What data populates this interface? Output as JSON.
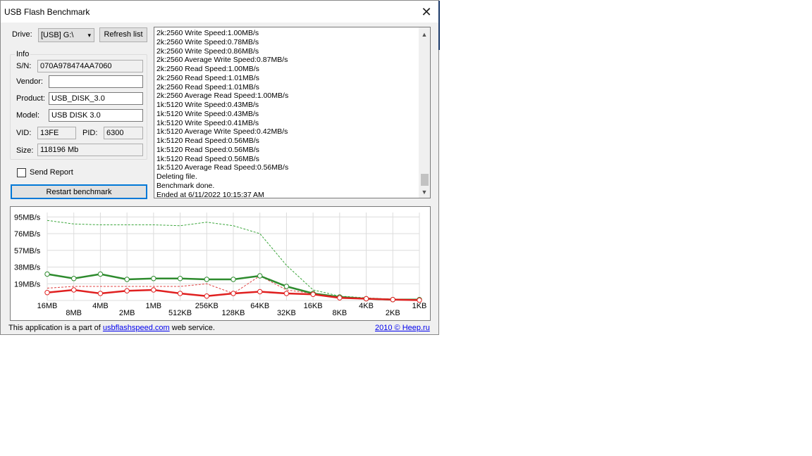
{
  "window": {
    "title": "USB Flash Benchmark",
    "close_glyph": "✕"
  },
  "drive": {
    "label": "Drive:",
    "selected": "[USB] G:\\",
    "refresh_label": "Refresh list"
  },
  "info": {
    "group_label": "Info",
    "sn_label": "S/N:",
    "sn_value": "070A978474AA7060",
    "vendor_label": "Vendor:",
    "vendor_value": "",
    "product_label": "Product:",
    "product_value": "USB_DISK_3.0",
    "model_label": "Model:",
    "model_value": "USB DISK 3.0",
    "vid_label": "VID:",
    "vid_value": "13FE",
    "pid_label": "PID:",
    "pid_value": "6300",
    "size_label": "Size:",
    "size_value": "118196 Mb"
  },
  "send_report": {
    "label": "Send Report",
    "checked": false
  },
  "restart_label": "Restart benchmark",
  "log": {
    "lines": [
      "2k:2560 Write Speed:1.00MB/s",
      "2k:2560 Write Speed:0.78MB/s",
      "2k:2560 Write Speed:0.86MB/s",
      "2k:2560 Average Write Speed:0.87MB/s",
      "2k:2560 Read Speed:1.00MB/s",
      "2k:2560 Read Speed:1.01MB/s",
      "2k:2560 Read Speed:1.01MB/s",
      "2k:2560 Average Read Speed:1.00MB/s",
      "1k:5120 Write Speed:0.43MB/s",
      "1k:5120 Write Speed:0.43MB/s",
      "1k:5120 Write Speed:0.41MB/s",
      "1k:5120 Average Write Speed:0.42MB/s",
      "1k:5120 Read Speed:0.56MB/s",
      "1k:5120 Read Speed:0.56MB/s",
      "1k:5120 Read Speed:0.56MB/s",
      "1k:5120 Average Read Speed:0.56MB/s",
      "Deleting file.",
      "Benchmark done.",
      "Ended at 6/11/2022 10:15:37 AM"
    ],
    "scroll_up": "▲",
    "scroll_down": "▼"
  },
  "footer": {
    "prefix": "This application is a part of ",
    "link": "usbflashspeed.com",
    "suffix": " web service.",
    "credit": "2010 © Heep.ru"
  },
  "colors": {
    "read": "#2e8b2e",
    "write": "#e02020",
    "read_max": "#3aa53a",
    "write_max": "#e04040",
    "grid": "#dcdcdc"
  },
  "chart_data": {
    "type": "line",
    "categories": [
      "16MB",
      "8MB",
      "4MB",
      "2MB",
      "1MB",
      "512KB",
      "256KB",
      "128KB",
      "64KB",
      "32KB",
      "16KB",
      "8KB",
      "4KB",
      "2KB",
      "1KB"
    ],
    "y_tick_labels": [
      "95MB/s",
      "76MB/s",
      "57MB/s",
      "38MB/s",
      "19MB/s"
    ],
    "y_ticks": [
      95,
      76,
      57,
      38,
      19
    ],
    "ylim": [
      0,
      100
    ],
    "series": [
      {
        "role": "read_avg",
        "values": [
          30,
          25,
          30,
          24,
          25,
          25,
          24,
          24,
          28,
          16,
          8,
          4,
          2,
          1,
          1
        ]
      },
      {
        "role": "write_avg",
        "values": [
          9,
          12,
          8,
          11,
          12,
          8,
          5,
          8,
          10,
          8,
          7,
          3,
          2,
          1,
          0.4
        ]
      },
      {
        "role": "read_max",
        "values": [
          91,
          87,
          86,
          86,
          86,
          85,
          89,
          85,
          76,
          40,
          12,
          5,
          3,
          1.5,
          1.2
        ]
      },
      {
        "role": "write_max",
        "values": [
          14,
          16,
          16,
          16,
          16,
          16,
          19,
          8,
          28,
          12,
          8,
          3,
          2,
          1,
          0.5
        ]
      }
    ]
  }
}
